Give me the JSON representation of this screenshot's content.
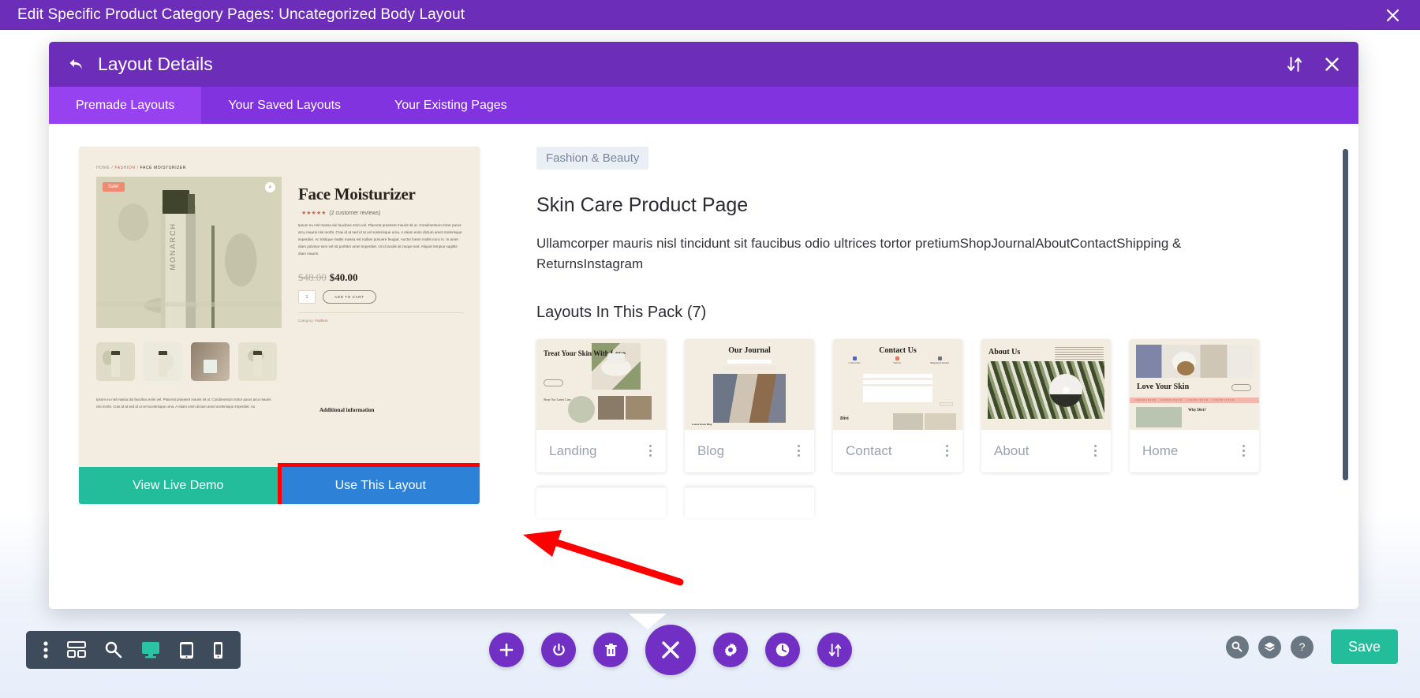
{
  "topbar": {
    "title": "Edit Specific Product Category Pages: Uncategorized Body Layout",
    "close_icon": "close-icon",
    "bg": "#6c2eb9"
  },
  "modal": {
    "back_icon": "back-arrow-icon",
    "title": "Layout Details",
    "sort_icon": "sort-icon",
    "close_icon": "close-icon",
    "tabs": [
      {
        "label": "Premade Layouts",
        "active": true
      },
      {
        "label": "Your Saved Layouts",
        "active": false
      },
      {
        "label": "Your Existing Pages",
        "active": false
      }
    ]
  },
  "preview": {
    "breadcrumb": {
      "home": "HOME",
      "sep1": "/",
      "cat": "FASHION",
      "sep2": "/",
      "current": "FACE MOISTURIZER"
    },
    "sale_badge": "Sale!",
    "zoom_icon": "magnify-icon",
    "product_title": "Face Moisturizer",
    "stars": "★★★★★",
    "reviews": "(2 customer reviews)",
    "description": "Ipsum eu nisl massa dui faucibus enim vel. Placerat praesent mauris sit ut. Condimentum tortor purus arcu mauris nisi morbi. Cras id at sed id ut vel scelerisque urna. A etiam enim dictum amet scelerisque imperdiet. Ac tristique mattis massa est nullam posuere feugiat. Auctor lorem mollis nunc in. In amet diam pulvinar sem vel sit porttitor amet imperdiet. Ut id iaculis sit neque sed. Aliquet tempus sagittis diam mauris.",
    "price_old": "$48.00",
    "price_new": "$40.00",
    "qty": "1",
    "add_to_cart": "ADD TO CART",
    "category_label": "Category:",
    "category_value": "Fashion",
    "bottle_word": "MONARCH",
    "footer_text": "Ipsum eu nisl massa dui faucibus enim vel. Placerat praesent mauris sit ut. Condimentum tortor purus arcu mauris nisi morbi. Cras id at sed id ut vel scelerisque urna. A etiam enim dictum amet scelerisque imperdiet. Au",
    "additional_information": "Additional information",
    "buttons": {
      "demo": "View Live Demo",
      "use": "Use This Layout"
    }
  },
  "detail": {
    "category_pill": "Fashion & Beauty",
    "pack_title": "Skin Care Product Page",
    "pack_description": "Ullamcorper mauris nisl tincidunt sit faucibus odio ultrices tortor pretiumShopJournalAboutContactShipping & ReturnsInstagram",
    "layouts_heading": "Layouts In This Pack (7)",
    "layouts": [
      {
        "name": "Landing",
        "thumb_title": "Treat Your Skin With Love",
        "thumb_sub": "Shop Our Latest Line",
        "kebab_icon": "kebab-menu-icon"
      },
      {
        "name": "Blog",
        "thumb_title": "Our Journal",
        "thumb_sub": "Latest From Blog",
        "kebab_icon": "kebab-menu-icon"
      },
      {
        "name": "Contact",
        "thumb_title": "Contact Us",
        "thumb_sub": "Divi",
        "kebab_icon": "kebab-menu-icon"
      },
      {
        "name": "About",
        "thumb_title": "About Us",
        "thumb_sub": "",
        "kebab_icon": "kebab-menu-icon"
      },
      {
        "name": "Home",
        "thumb_title": "Love Your Skin",
        "thumb_sub": "Why Divi?",
        "kebab_icon": "kebab-menu-icon"
      }
    ],
    "contact_cols": [
      "Contact Info",
      "Visit Us",
      "Shipping & Returns"
    ]
  },
  "bottom_bar": {
    "left_tools": [
      {
        "name": "more-options-icon",
        "label": "More Options",
        "active": false
      },
      {
        "name": "wireframe-icon",
        "label": "Wireframe View",
        "active": false
      },
      {
        "name": "zoom-out-icon",
        "label": "Zoom Out",
        "active": false
      },
      {
        "name": "desktop-icon",
        "label": "Desktop View",
        "active": true
      },
      {
        "name": "tablet-icon",
        "label": "Tablet View",
        "active": false
      },
      {
        "name": "phone-icon",
        "label": "Phone View",
        "active": false
      }
    ],
    "center_tools": [
      {
        "name": "add-section-icon",
        "label": "Add Section",
        "big": false
      },
      {
        "name": "power-toggle-icon",
        "label": "Toggle Builder",
        "big": false
      },
      {
        "name": "trash-icon",
        "label": "Clear Layout",
        "big": false
      },
      {
        "name": "close-menu-icon",
        "label": "Close Menu",
        "big": true
      },
      {
        "name": "gear-icon",
        "label": "Page Settings",
        "big": false
      },
      {
        "name": "history-icon",
        "label": "Editing History",
        "big": false
      },
      {
        "name": "portability-icon",
        "label": "Portability",
        "big": false
      }
    ],
    "right_tools": [
      {
        "name": "search-icon",
        "label": "Search"
      },
      {
        "name": "layers-icon",
        "label": "Layers View"
      },
      {
        "name": "help-icon",
        "label": "Help"
      }
    ],
    "save_label": "Save",
    "save_color": "#23bd9b"
  },
  "annotation": {
    "arrow_color": "#ff0000",
    "highlight_color": "#ff0000",
    "highlight_target": "Use This Layout"
  }
}
